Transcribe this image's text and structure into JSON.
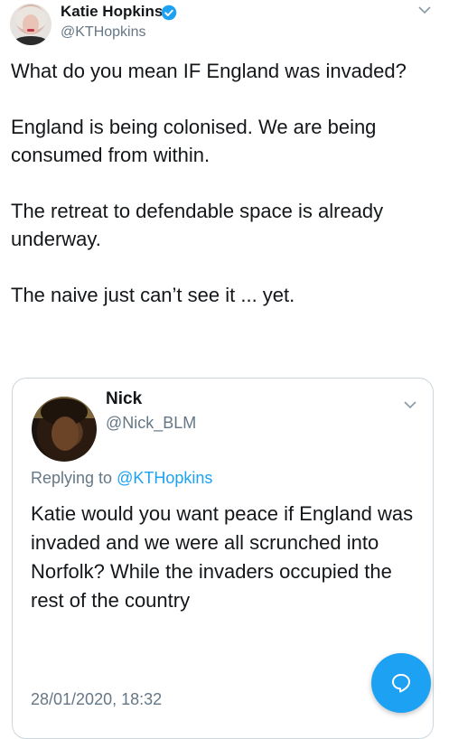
{
  "tweet": {
    "author_name": "Katie Hopkins",
    "author_handle": "@KTHopkins",
    "paragraphs": [
      "What do you mean IF England was invaded?",
      "England is being colonised. We are being consumed from within.",
      "The retreat to defendable space is already underway.",
      "The naive just can’t see it ... yet."
    ]
  },
  "quoted_tweet": {
    "author_name": "Nick",
    "author_handle": "@Nick_BLM",
    "replying_prefix": "Replying to",
    "replying_mention": "@KTHopkins",
    "text": "Katie would you want peace if England was invaded and we were all scrunched into Norfolk? While the invaders occupied the rest of the country",
    "timestamp": "28/01/2020, 18:32"
  },
  "icons": {
    "verified": "verified-badge-icon",
    "caret": "chevron-down-icon",
    "compose": "compose-reply-icon"
  },
  "colors": {
    "accent": "#1da1f2",
    "secondary_text": "#657786",
    "border": "#ccd6dd"
  }
}
